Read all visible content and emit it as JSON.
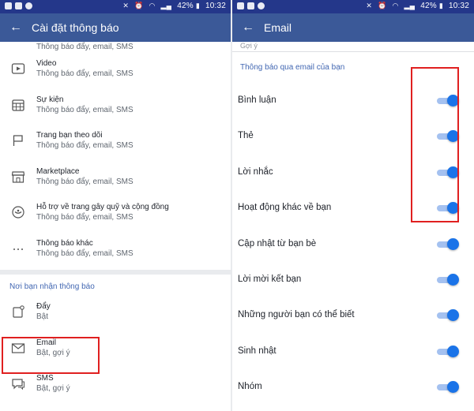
{
  "left": {
    "status": {
      "battery": "42%",
      "time": "10:32"
    },
    "header": {
      "title": "Cài đặt thông báo"
    },
    "partial_subtitle": "Thông báo đẩy, email, SMS",
    "items": [
      {
        "title": "Video",
        "subtitle": "Thông báo đẩy, email, SMS",
        "icon": "video-icon"
      },
      {
        "title": "Sự kiện",
        "subtitle": "Thông báo đẩy, email, SMS",
        "icon": "calendar-icon"
      },
      {
        "title": "Trang bạn theo dõi",
        "subtitle": "Thông báo đẩy, email, SMS",
        "icon": "flag-icon"
      },
      {
        "title": "Marketplace",
        "subtitle": "Thông báo đẩy, email, SMS",
        "icon": "marketplace-icon"
      },
      {
        "title": "Hỗ trợ về trang gây quỹ và cộng đồng",
        "subtitle": "Thông báo đẩy, email, SMS",
        "icon": "fundraiser-icon"
      },
      {
        "title": "Thông báo khác",
        "subtitle": "Thông báo đẩy, email, SMS",
        "icon": "more-dots-icon"
      }
    ],
    "section_label": "Nơi bạn nhận thông báo",
    "channels": [
      {
        "title": "Đẩy",
        "subtitle": "Bật",
        "icon": "push-icon"
      },
      {
        "title": "Email",
        "subtitle": "Bật, gợi ý",
        "icon": "email-icon"
      },
      {
        "title": "SMS",
        "subtitle": "Bật, gợi ý",
        "icon": "sms-icon"
      }
    ]
  },
  "right": {
    "status": {
      "battery": "42%",
      "time": "10:32"
    },
    "header": {
      "title": "Email"
    },
    "partial_subtitle": "Gợi ý",
    "section_label": "Thông báo qua email của bạn",
    "toggles": [
      {
        "label": "Bình luận",
        "on": true
      },
      {
        "label": "Thẻ",
        "on": true
      },
      {
        "label": "Lời nhắc",
        "on": true
      },
      {
        "label": "Hoạt động khác về bạn",
        "on": true
      },
      {
        "label": "Cập nhật từ bạn bè",
        "on": true
      },
      {
        "label": "Lời mời kết bạn",
        "on": true
      },
      {
        "label": "Những người bạn có thể biết",
        "on": true
      },
      {
        "label": "Sinh nhật",
        "on": true
      },
      {
        "label": "Nhóm",
        "on": true
      }
    ]
  },
  "colors": {
    "statusbar": "#24378a",
    "appbar": "#3b5998",
    "accent_link": "#4267b2",
    "toggle_on": "#1a73e8",
    "highlight": "#e02020"
  }
}
